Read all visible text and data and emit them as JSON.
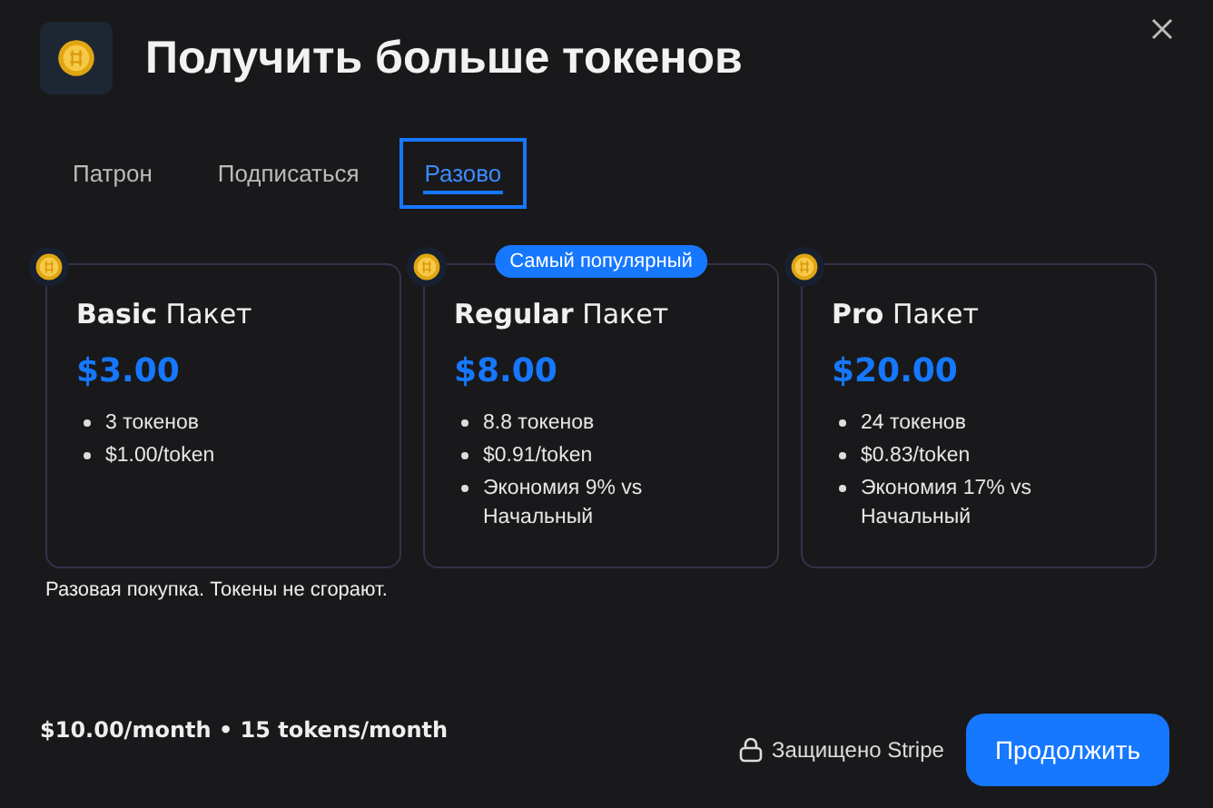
{
  "header": {
    "title": "Получить больше токенов"
  },
  "tabs": [
    {
      "label": "Патрон",
      "selected": false
    },
    {
      "label": "Подписаться",
      "selected": false
    },
    {
      "label": "Разово",
      "selected": true
    }
  ],
  "packages": [
    {
      "title": "**Basic** Пакет",
      "price": "$3.00",
      "features": [
        "3 токенов",
        "$1.00/token"
      ]
    },
    {
      "title": "**Regular** Пакет",
      "price": "$8.00",
      "badge": "Самый популярный",
      "features": [
        "8.8 токенов",
        "$0.91/token",
        "Экономия 9% vs Начальный"
      ]
    },
    {
      "title": "**Pro** Пакет",
      "price": "$20.00",
      "features": [
        "24 токенов",
        "$0.83/token",
        "Экономия 17% vs Начальный"
      ]
    }
  ],
  "note": "Разовая покупка. Токены не сгорают.",
  "footer": {
    "summary": "$10.00/month • 15 tokens/month",
    "secure": "Защищено Stripe",
    "button": "Продолжить"
  }
}
